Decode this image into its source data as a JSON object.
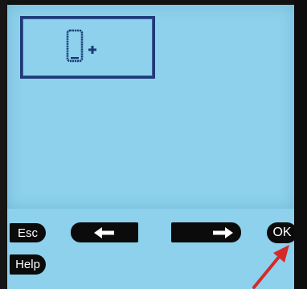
{
  "screen": {
    "tile": {
      "icon": "phone-plus-icon"
    }
  },
  "softkeys": {
    "esc_label": "Esc",
    "help_label": "Help",
    "left_icon": "arrow-left-icon",
    "right_icon": "arrow-right-icon",
    "ok_label": "OK"
  },
  "annotation": {
    "pointer_icon": "red-arrow-icon",
    "pointer_color": "#d42a2a"
  },
  "colors": {
    "screen_background": "#8dd1ec",
    "lcd_ink": "#1d3a78",
    "softkey": "#0b0b0b"
  }
}
